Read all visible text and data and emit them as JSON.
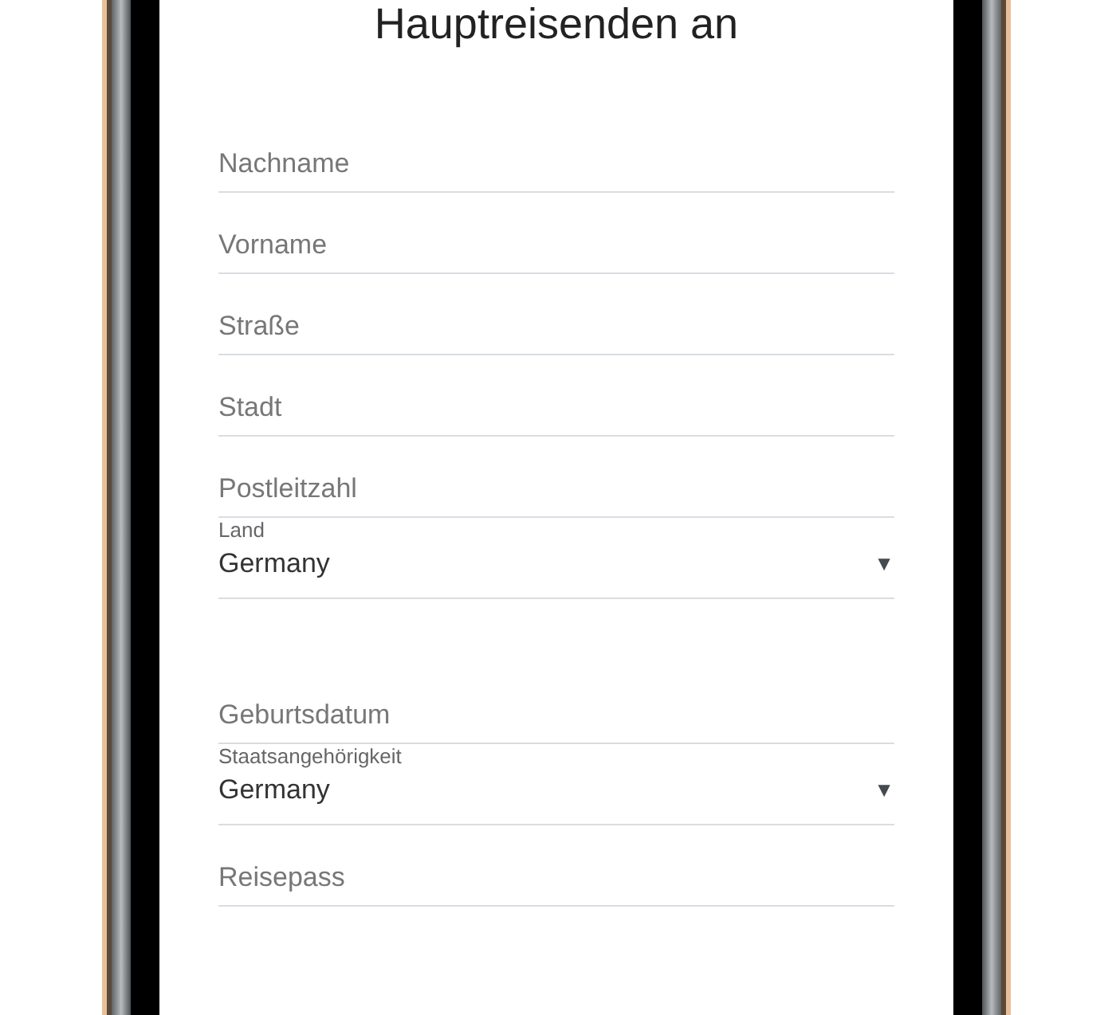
{
  "title": "Hauptreisenden an",
  "fields": [
    {
      "kind": "text",
      "placeholder": "Nachname"
    },
    {
      "kind": "text",
      "placeholder": "Vorname"
    },
    {
      "kind": "text",
      "placeholder": "Straße"
    },
    {
      "kind": "text",
      "placeholder": "Stadt"
    },
    {
      "kind": "text",
      "placeholder": "Postleitzahl"
    },
    {
      "kind": "select",
      "label": "Land",
      "value": "Germany",
      "caret": "▼"
    },
    {
      "kind": "gap"
    },
    {
      "kind": "text",
      "placeholder": "Geburtsdatum"
    },
    {
      "kind": "select",
      "label": "Staatsangehörigkeit",
      "value": "Germany",
      "caret": "▼"
    },
    {
      "kind": "text",
      "placeholder": "Reisepass"
    }
  ]
}
